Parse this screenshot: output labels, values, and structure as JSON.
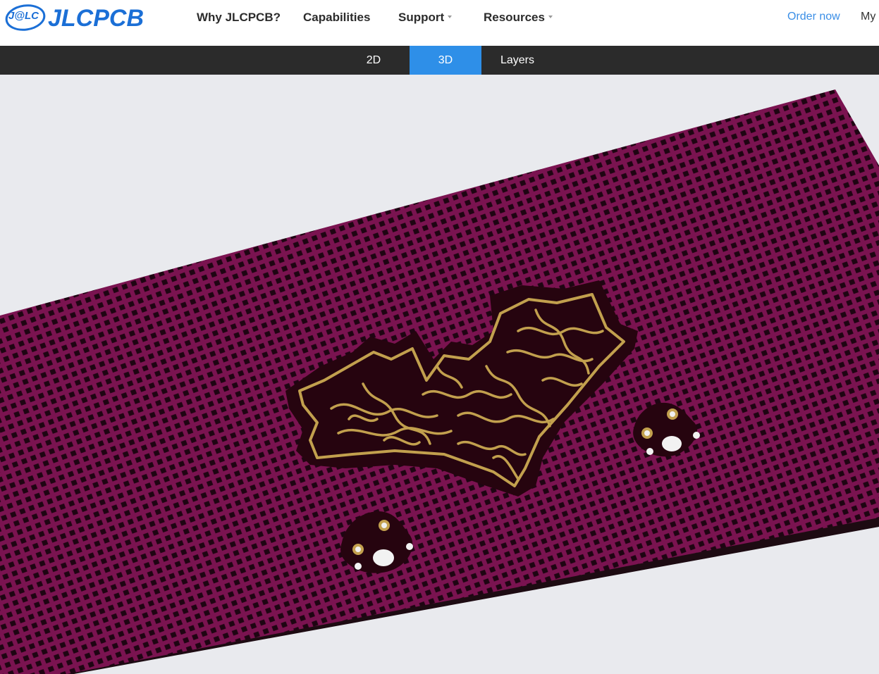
{
  "header": {
    "logo": {
      "badge_text": "J@LC",
      "brand_text": "JLCPCB"
    },
    "nav": [
      {
        "label": "Why JLCPCB?",
        "has_dropdown": false
      },
      {
        "label": "Capabilities",
        "has_dropdown": false
      },
      {
        "label": "Support",
        "has_dropdown": true
      },
      {
        "label": "Resources",
        "has_dropdown": true
      }
    ],
    "order_now": "Order now",
    "my_account": "My"
  },
  "viewer_tabs": [
    {
      "label": "2D",
      "active": false
    },
    {
      "label": "3D",
      "active": true
    },
    {
      "label": "Layers",
      "active": false
    }
  ],
  "viewer": {
    "view_mode": "3D",
    "board": {
      "soldermask_color": "#7a1350",
      "silkscreen_color": "#c2a04e",
      "grid_pattern": "square-mesh",
      "artwork_icon": "crown-ornament-icon",
      "mounting_holes": 2
    }
  },
  "colors": {
    "accent": "#2e8fe8",
    "brand": "#1b6fd6",
    "tabbar_bg": "#2b2b2b"
  }
}
